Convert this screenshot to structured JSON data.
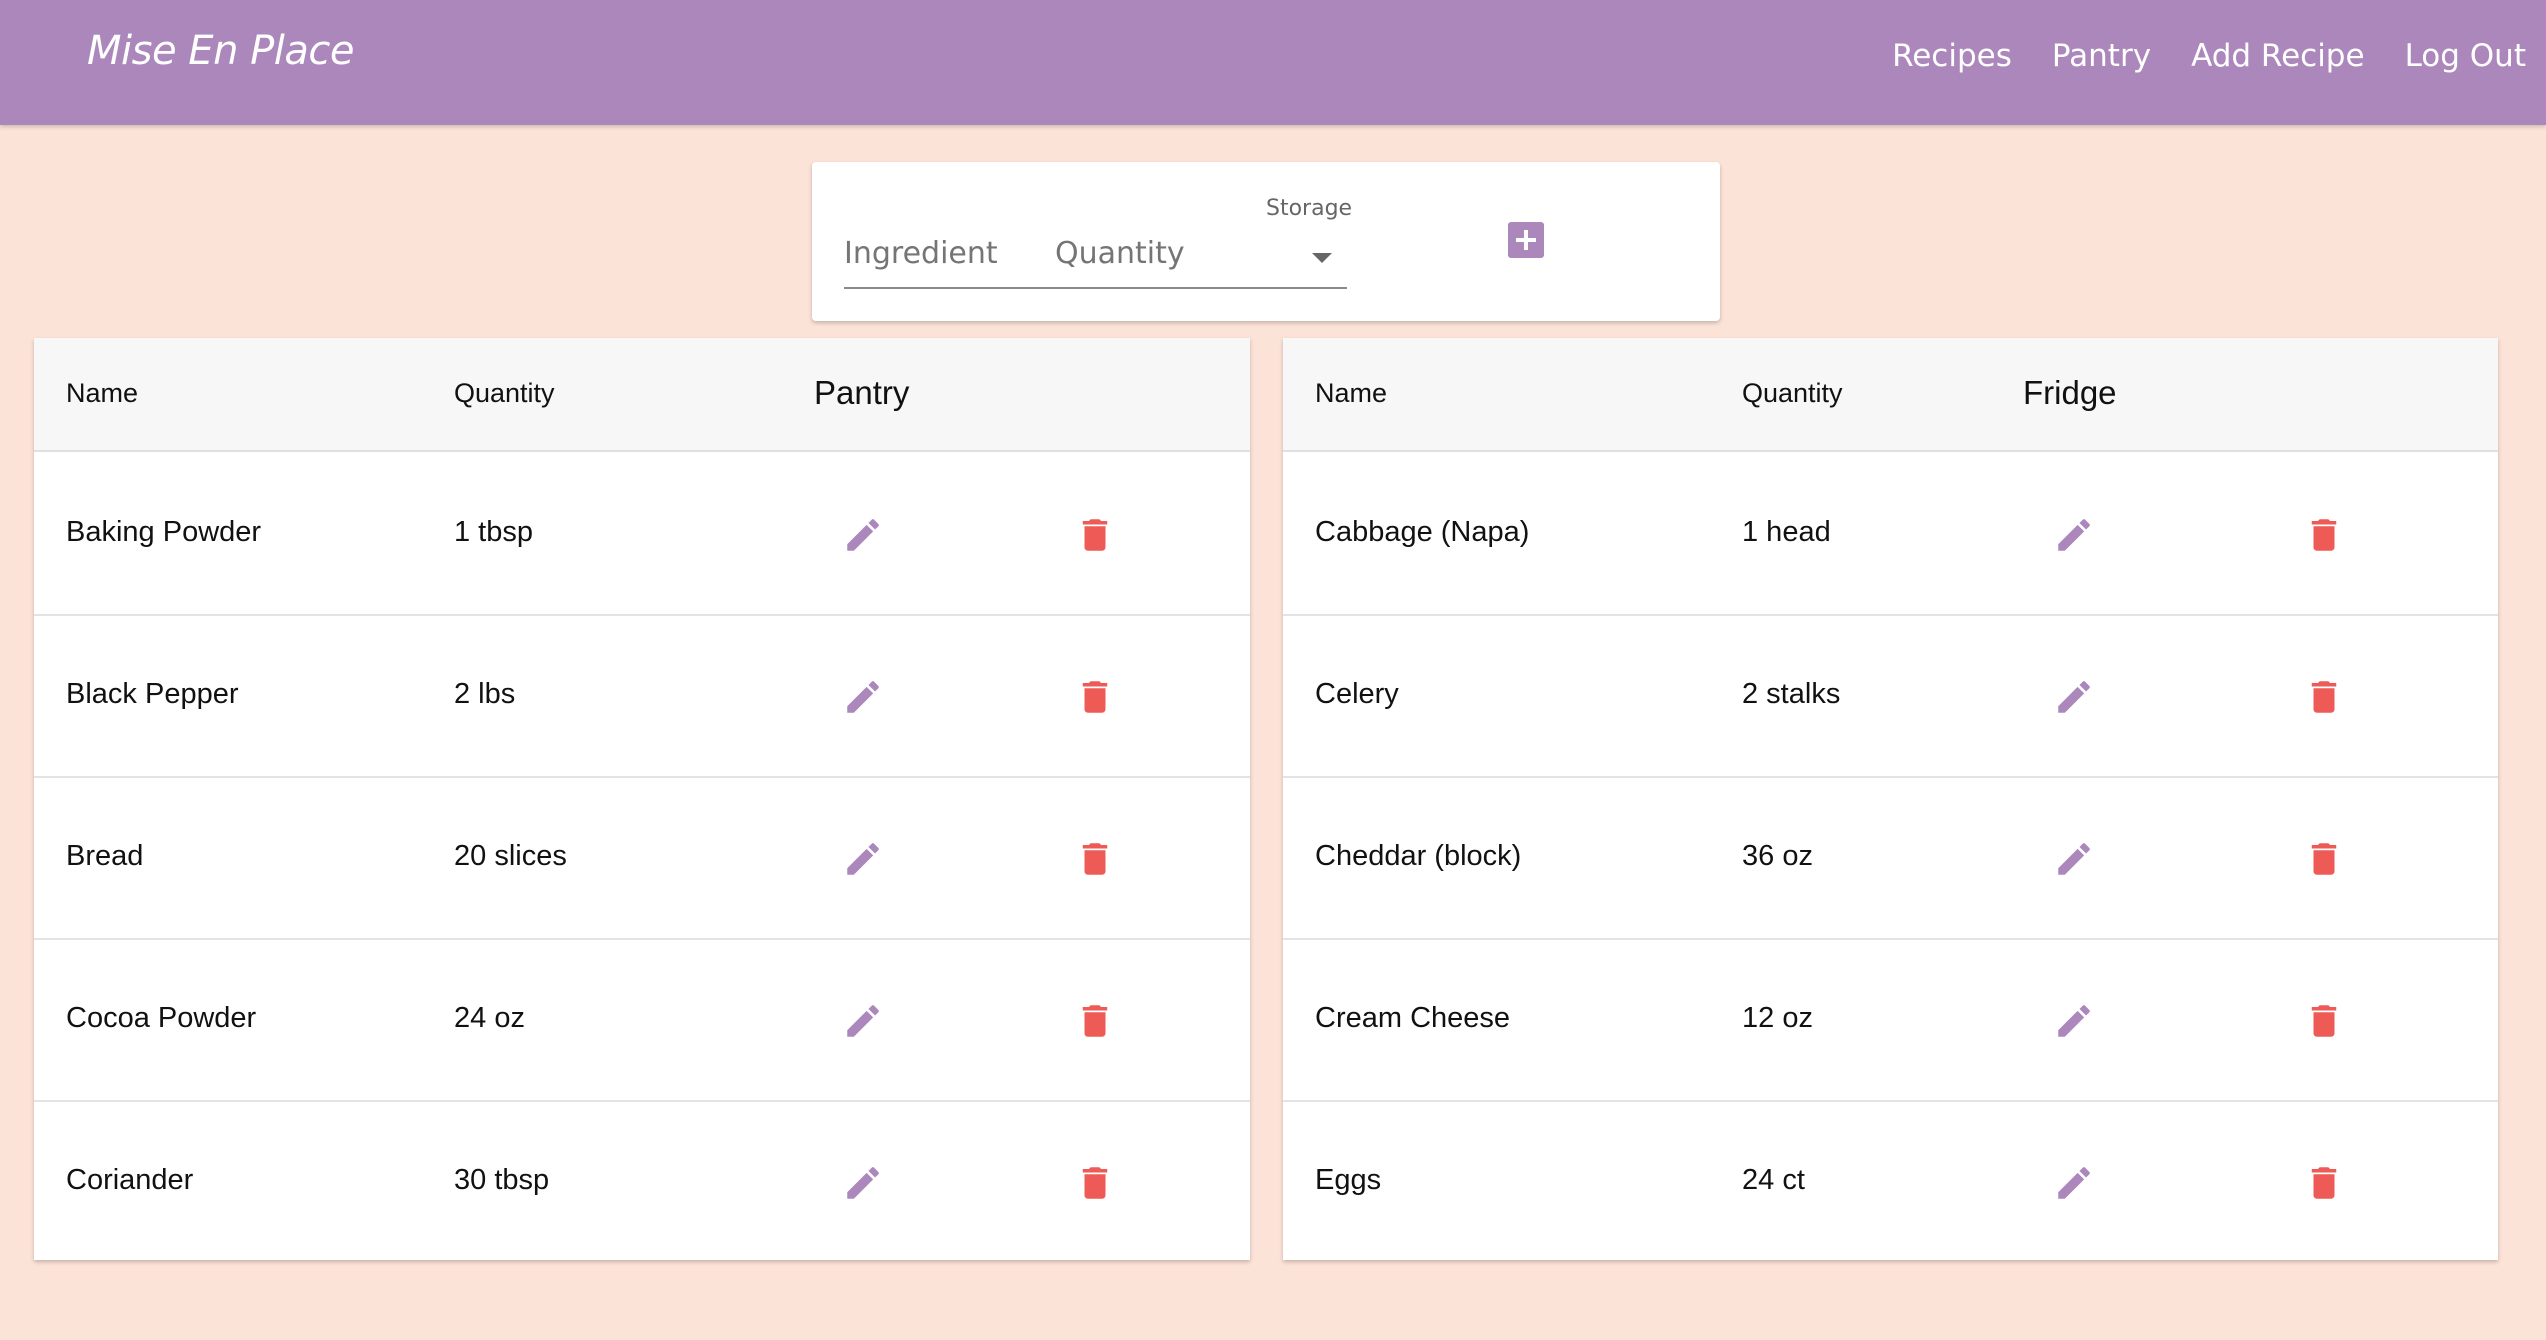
{
  "header": {
    "brand": "Mise En Place",
    "nav": [
      "Recipes",
      "Pantry",
      "Add Recipe",
      "Log Out"
    ]
  },
  "add_form": {
    "ingredient_placeholder": "Ingredient",
    "quantity_placeholder": "Quantity",
    "storage_label": "Storage"
  },
  "tables": [
    {
      "title": "Pantry",
      "columns": [
        "Name",
        "Quantity"
      ],
      "rows": [
        {
          "name": "Baking Powder",
          "quantity": "1 tbsp"
        },
        {
          "name": "Black Pepper",
          "quantity": "2 lbs"
        },
        {
          "name": "Bread",
          "quantity": "20 slices"
        },
        {
          "name": "Cocoa Powder",
          "quantity": "24 oz"
        },
        {
          "name": "Coriander",
          "quantity": "30 tbsp"
        }
      ]
    },
    {
      "title": "Fridge",
      "columns": [
        "Name",
        "Quantity"
      ],
      "rows": [
        {
          "name": "Cabbage (Napa)",
          "quantity": "1 head"
        },
        {
          "name": "Celery",
          "quantity": "2 stalks"
        },
        {
          "name": "Cheddar (block)",
          "quantity": "36 oz"
        },
        {
          "name": "Cream Cheese",
          "quantity": "12 oz"
        },
        {
          "name": "Eggs",
          "quantity": "24 ct"
        }
      ]
    }
  ],
  "colors": {
    "accent": "#ab87bc",
    "background": "#fce3d8",
    "delete": "#ee5b57"
  },
  "icons": [
    "pencil-icon",
    "trash-icon",
    "plus-icon",
    "caret-down-icon"
  ]
}
